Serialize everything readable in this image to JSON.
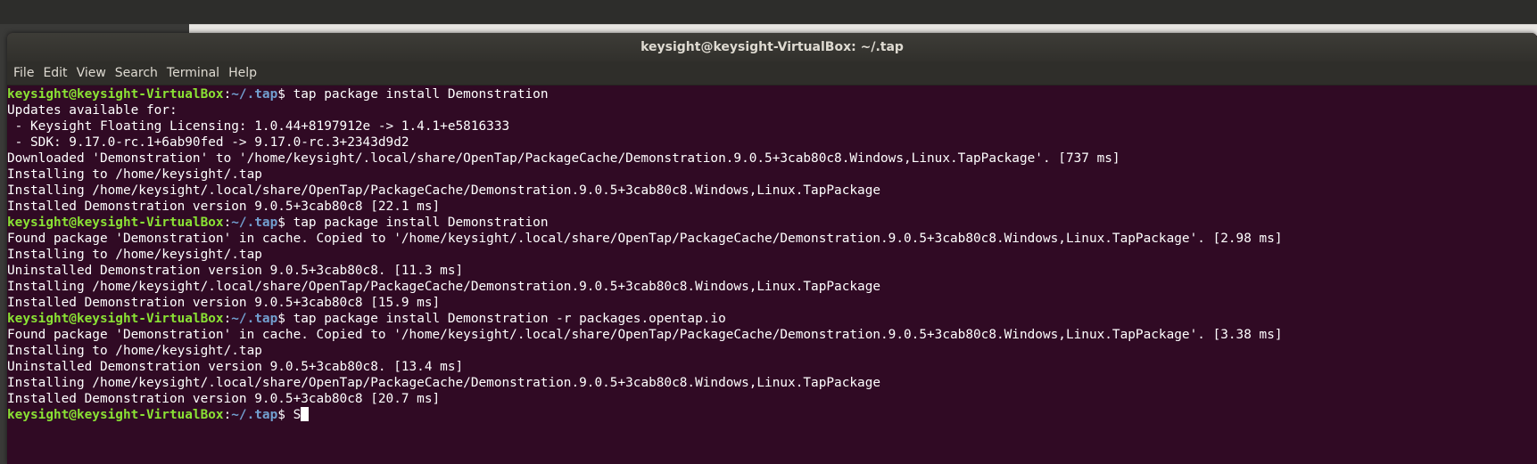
{
  "window": {
    "title": "keysight@keysight-VirtualBox: ~/.tap"
  },
  "menu": [
    "File",
    "Edit",
    "View",
    "Search",
    "Terminal",
    "Help"
  ],
  "prompt": {
    "user": "keysight@keysight-VirtualBox",
    "sep": ":",
    "path": "~/.tap",
    "symbol": "$ "
  },
  "lines": [
    {
      "type": "prompt",
      "command": "tap package install Demonstration"
    },
    {
      "type": "output",
      "text": "Updates available for:"
    },
    {
      "type": "output",
      "text": " - Keysight Floating Licensing: 1.0.44+8197912e -> 1.4.1+e5816333"
    },
    {
      "type": "output",
      "text": " - SDK: 9.17.0-rc.1+6ab90fed -> 9.17.0-rc.3+2343d9d2"
    },
    {
      "type": "output",
      "text": "Downloaded 'Demonstration' to '/home/keysight/.local/share/OpenTap/PackageCache/Demonstration.9.0.5+3cab80c8.Windows,Linux.TapPackage'. [737 ms]"
    },
    {
      "type": "output",
      "text": "Installing to /home/keysight/.tap"
    },
    {
      "type": "output",
      "text": "Installing /home/keysight/.local/share/OpenTap/PackageCache/Demonstration.9.0.5+3cab80c8.Windows,Linux.TapPackage"
    },
    {
      "type": "output",
      "text": "Installed Demonstration version 9.0.5+3cab80c8 [22.1 ms]"
    },
    {
      "type": "prompt",
      "command": "tap package install Demonstration"
    },
    {
      "type": "output",
      "text": "Found package 'Demonstration' in cache. Copied to '/home/keysight/.local/share/OpenTap/PackageCache/Demonstration.9.0.5+3cab80c8.Windows,Linux.TapPackage'. [2.98 ms]"
    },
    {
      "type": "output",
      "text": "Installing to /home/keysight/.tap"
    },
    {
      "type": "output",
      "text": "Uninstalled Demonstration version 9.0.5+3cab80c8. [11.3 ms]"
    },
    {
      "type": "output",
      "text": "Installing /home/keysight/.local/share/OpenTap/PackageCache/Demonstration.9.0.5+3cab80c8.Windows,Linux.TapPackage"
    },
    {
      "type": "output",
      "text": "Installed Demonstration version 9.0.5+3cab80c8 [15.9 ms]"
    },
    {
      "type": "prompt",
      "command": "tap package install Demonstration -r packages.opentap.io"
    },
    {
      "type": "output",
      "text": "Found package 'Demonstration' in cache. Copied to '/home/keysight/.local/share/OpenTap/PackageCache/Demonstration.9.0.5+3cab80c8.Windows,Linux.TapPackage'. [3.38 ms]"
    },
    {
      "type": "output",
      "text": "Installing to /home/keysight/.tap"
    },
    {
      "type": "output",
      "text": "Uninstalled Demonstration version 9.0.5+3cab80c8. [13.4 ms]"
    },
    {
      "type": "output",
      "text": "Installing /home/keysight/.local/share/OpenTap/PackageCache/Demonstration.9.0.5+3cab80c8.Windows,Linux.TapPackage"
    },
    {
      "type": "output",
      "text": "Installed Demonstration version 9.0.5+3cab80c8 [20.7 ms]"
    },
    {
      "type": "prompt",
      "command": "S",
      "cursor": true
    }
  ],
  "colors": {
    "background": "#300a24",
    "prompt_user": "#8ae234",
    "prompt_path": "#729fcf",
    "text": "#ffffff"
  }
}
